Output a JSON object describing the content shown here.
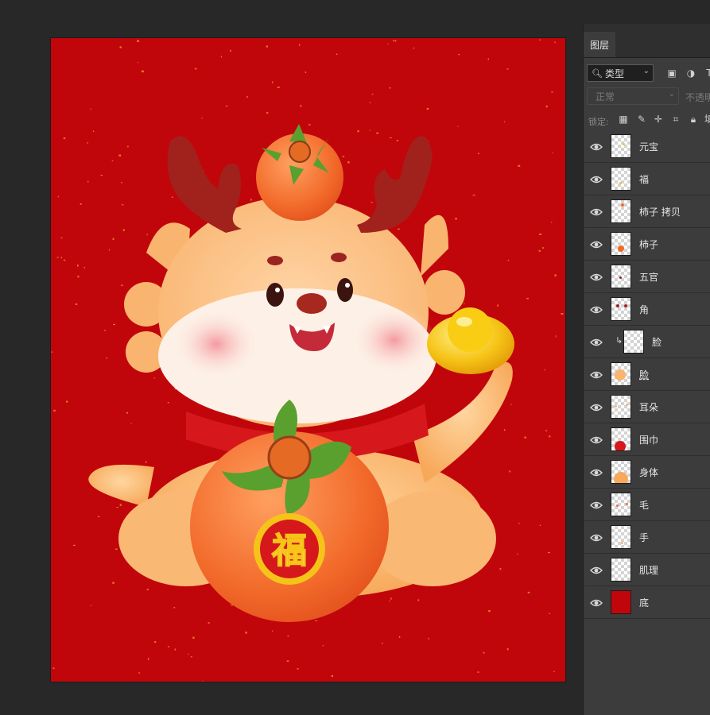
{
  "panel": {
    "tab_label": "图层",
    "filter_label": "类型",
    "blend_mode": "正常",
    "opacity_label": "不透明",
    "lock_label": "锁定:",
    "filter_icons": [
      "image-filter-icon",
      "adjustment-filter-icon",
      "text-filter-icon"
    ],
    "lock_icons": [
      "lock-transparent-icon",
      "lock-paint-icon",
      "lock-move-icon",
      "lock-artboard-icon",
      "lock-all-icon"
    ]
  },
  "layers": [
    {
      "name": "元宝",
      "visible": true,
      "clipped": false
    },
    {
      "name": "福",
      "visible": true,
      "clipped": false
    },
    {
      "name": "柿子 拷贝",
      "visible": true,
      "clipped": false
    },
    {
      "name": "柿子",
      "visible": true,
      "clipped": false
    },
    {
      "name": "五官",
      "visible": true,
      "clipped": false
    },
    {
      "name": "角",
      "visible": true,
      "clipped": false
    },
    {
      "name": "脸",
      "visible": true,
      "clipped": true
    },
    {
      "name": "脸",
      "visible": true,
      "clipped": false
    },
    {
      "name": "耳朵",
      "visible": true,
      "clipped": false
    },
    {
      "name": "围巾",
      "visible": true,
      "clipped": false
    },
    {
      "name": "身体",
      "visible": true,
      "clipped": false
    },
    {
      "name": "毛",
      "visible": true,
      "clipped": false
    },
    {
      "name": "手",
      "visible": true,
      "clipped": false
    },
    {
      "name": "肌理",
      "visible": true,
      "clipped": false
    },
    {
      "name": "底",
      "visible": true,
      "clipped": false
    }
  ],
  "canvas": {
    "background_color": "#c1060b",
    "badge_text": "福"
  }
}
